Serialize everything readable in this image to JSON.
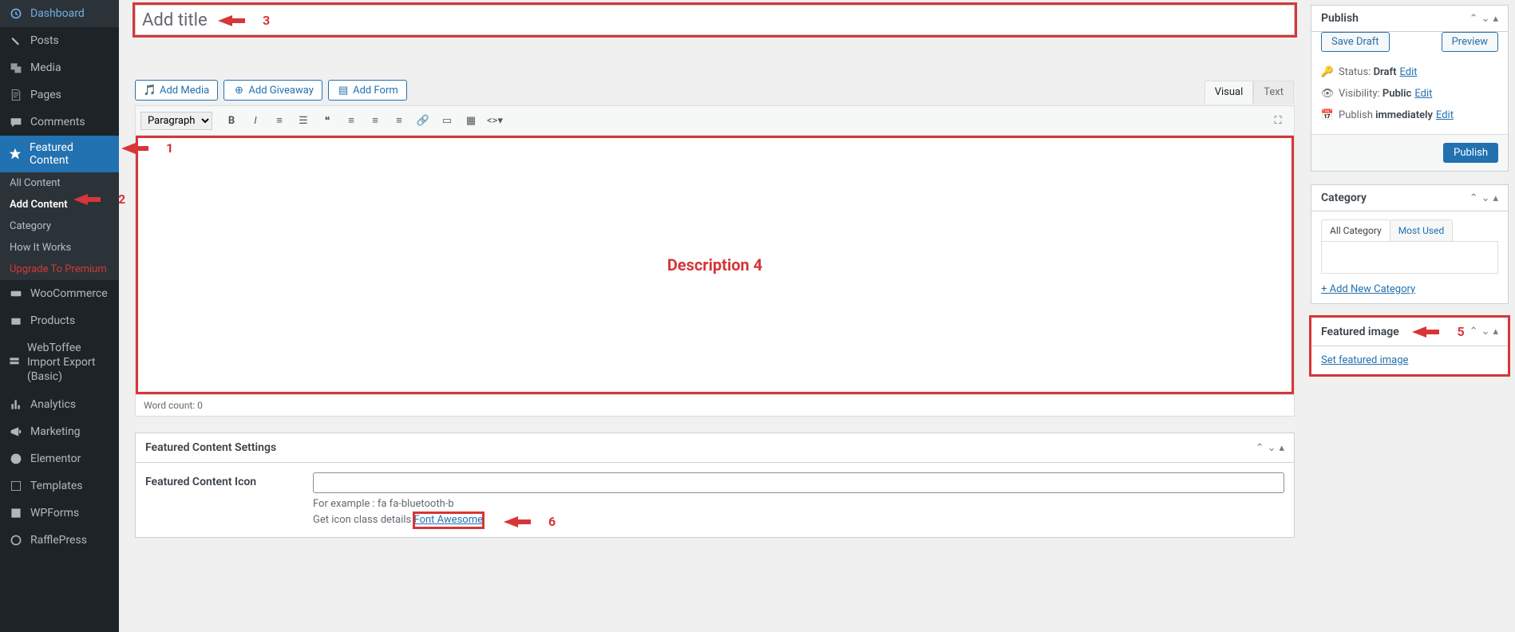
{
  "sidebar": {
    "items": [
      {
        "label": "Dashboard",
        "icon": "dashboard-icon"
      },
      {
        "label": "Posts",
        "icon": "pin-icon"
      },
      {
        "label": "Media",
        "icon": "media-icon"
      },
      {
        "label": "Pages",
        "icon": "page-icon"
      },
      {
        "label": "Comments",
        "icon": "comment-icon"
      },
      {
        "label": "Featured Content",
        "icon": "star-icon",
        "active": true
      },
      {
        "label": "WooCommerce",
        "icon": "woo-icon"
      },
      {
        "label": "Products",
        "icon": "products-icon"
      },
      {
        "label": "WebToffee Import Export (Basic)",
        "icon": "import-icon"
      },
      {
        "label": "Analytics",
        "icon": "analytics-icon"
      },
      {
        "label": "Marketing",
        "icon": "megaphone-icon"
      },
      {
        "label": "Elementor",
        "icon": "elementor-icon"
      },
      {
        "label": "Templates",
        "icon": "templates-icon"
      },
      {
        "label": "WPForms",
        "icon": "wpforms-icon"
      },
      {
        "label": "RafflePress",
        "icon": "rafflepress-icon"
      }
    ],
    "sub": [
      {
        "label": "All Content"
      },
      {
        "label": "Add Content",
        "current": true
      },
      {
        "label": "Category"
      },
      {
        "label": "How It Works"
      },
      {
        "label": "Upgrade To Premium",
        "premium": true
      }
    ]
  },
  "title": {
    "placeholder": "Add title"
  },
  "mediaButtons": {
    "addMedia": "Add Media",
    "addGiveaway": "Add Giveaway",
    "addForm": "Add Form"
  },
  "editor": {
    "tabs": {
      "visual": "Visual",
      "text": "Text"
    },
    "paragraph": "Paragraph",
    "wordCount": "Word count: 0",
    "descriptionLabel": "Description  4"
  },
  "settings": {
    "title": "Featured Content Settings",
    "iconLabel": "Featured Content Icon",
    "example": "For example : fa fa-bluetooth-b",
    "iconDetails": "Get icon class details",
    "fontAwesome": "Font Awesome"
  },
  "publish": {
    "title": "Publish",
    "saveDraft": "Save Draft",
    "preview": "Preview",
    "statusLabel": "Status:",
    "statusValue": "Draft",
    "visibilityLabel": "Visibility:",
    "visibilityValue": "Public",
    "scheduleLabel": "Publish",
    "scheduleValue": "immediately",
    "edit": "Edit",
    "publishBtn": "Publish"
  },
  "category": {
    "title": "Category",
    "allTab": "All Category",
    "mostUsedTab": "Most Used",
    "addNew": "+ Add New Category"
  },
  "featuredImage": {
    "title": "Featured image",
    "setLink": "Set featured image"
  },
  "annotations": {
    "n1": "1",
    "n2": "2",
    "n3": "3",
    "n5": "5",
    "n6": "6"
  }
}
